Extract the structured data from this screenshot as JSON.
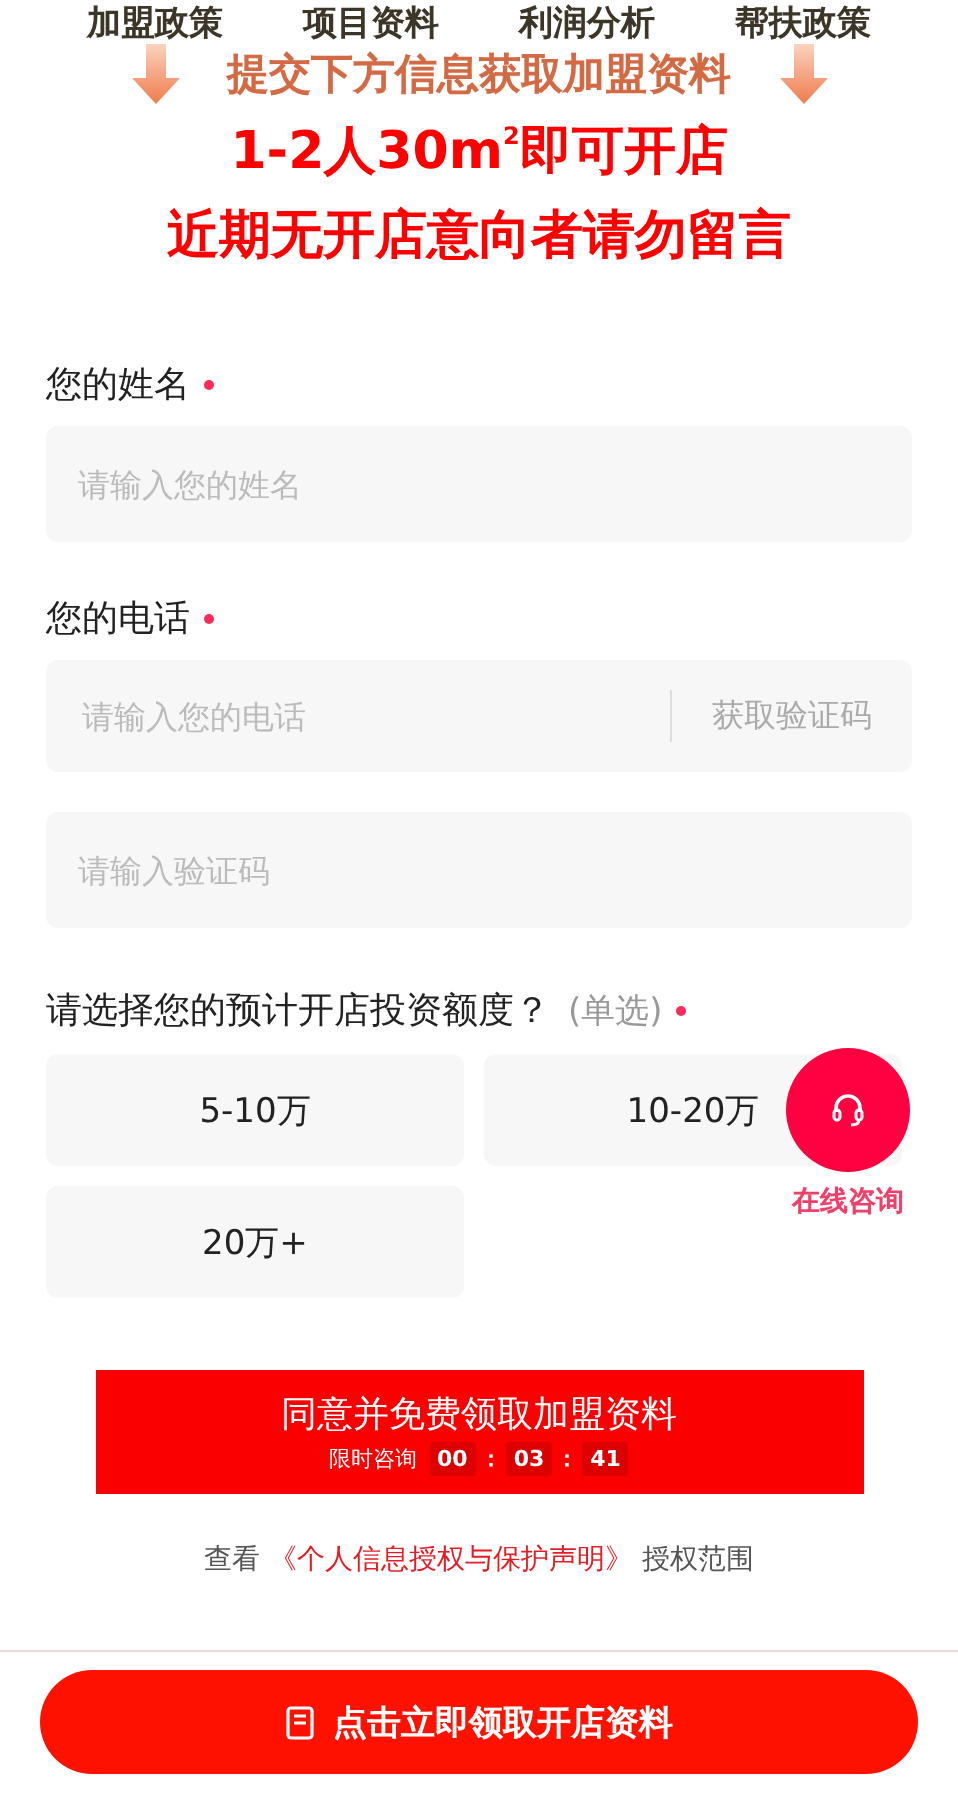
{
  "banner": {
    "tabs": [
      "加盟政策",
      "项目资料",
      "利润分析",
      "帮扶政策"
    ],
    "subtitle": "提交下方信息获取加盟资料",
    "headline": "1-2人30m$^{2}$即可开店",
    "warning": "近期无开店意向者请勿留言"
  },
  "form": {
    "fields": [
      {
        "kind": "text",
        "label": "您的姓名",
        "required": true,
        "placeholder": "请输入您的姓名"
      },
      {
        "kind": "phone",
        "label": "您的电话",
        "required": true,
        "placeholder": "请输入您的电话",
        "action": "获取验证码"
      },
      {
        "kind": "code",
        "placeholder": "请输入验证码"
      }
    ],
    "question": {
      "label": "请选择您的预计开店投资额度？",
      "hint": "(单选)",
      "required": true
    },
    "options": [
      {
        "label": "5-10万",
        "selected": false
      },
      {
        "label": "10-20万",
        "selected": false
      },
      {
        "label": "20万+",
        "selected": false
      }
    ],
    "submit": {
      "label": "同意并免费领取加盟资料",
      "countdown_label": "限时咨询",
      "countdown": [
        "00",
        "03",
        "41"
      ],
      "separators": [
        "：",
        "："
      ]
    },
    "consent": {
      "prefix": "查看",
      "link": "《个人信息授权与保护声明》",
      "suffix": "授权范围"
    }
  },
  "chat": {
    "label": "在线咨询"
  },
  "bottom_bar": {
    "button": "点击立即领取开店资料"
  }
}
